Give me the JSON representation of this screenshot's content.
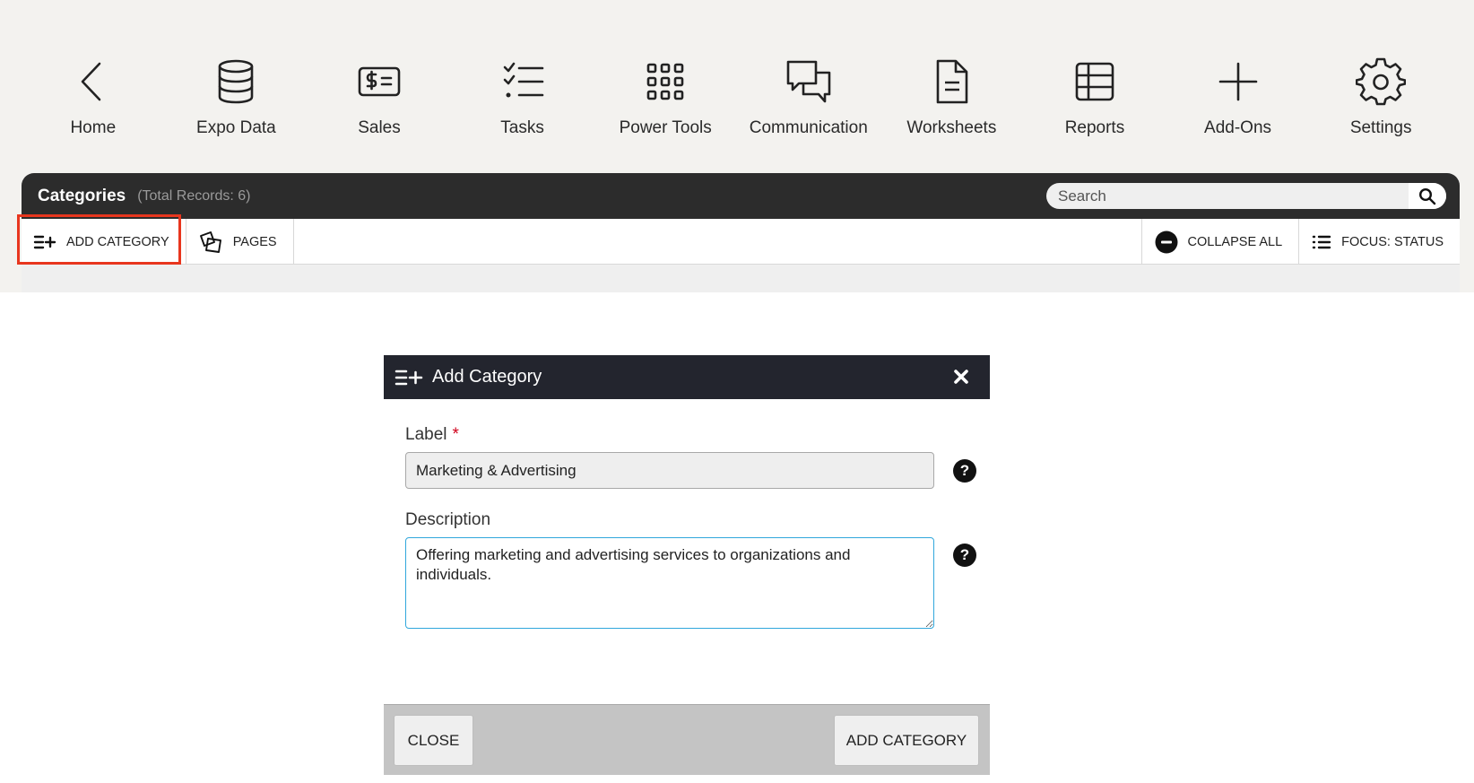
{
  "nav": {
    "items": [
      {
        "label": "Home",
        "icon": "chevron-left-icon"
      },
      {
        "label": "Expo Data",
        "icon": "database-icon"
      },
      {
        "label": "Sales",
        "icon": "dollar-bill-icon"
      },
      {
        "label": "Tasks",
        "icon": "checklist-icon"
      },
      {
        "label": "Power Tools",
        "icon": "grid-dots-icon"
      },
      {
        "label": "Communication",
        "icon": "chat-bubbles-icon"
      },
      {
        "label": "Worksheets",
        "icon": "document-icon"
      },
      {
        "label": "Reports",
        "icon": "table-icon"
      },
      {
        "label": "Add-Ons",
        "icon": "plus-icon"
      },
      {
        "label": "Settings",
        "icon": "gear-icon"
      }
    ]
  },
  "panel": {
    "title": "Categories",
    "count": "(Total Records: 6)",
    "search_placeholder": "Search"
  },
  "toolbar": {
    "add_category": "ADD CATEGORY",
    "pages": "PAGES",
    "collapse_all": "COLLAPSE ALL",
    "focus_status": "FOCUS: STATUS"
  },
  "modal": {
    "title": "Add Category",
    "label_field": {
      "label": "Label",
      "required_mark": "*",
      "value": "Marketing & Advertising"
    },
    "description_field": {
      "label": "Description",
      "value": "Offering marketing and advertising services to organizations and individuals."
    },
    "help_glyph": "?",
    "close_button": "CLOSE",
    "submit_button": "ADD CATEGORY"
  },
  "colors": {
    "header_dark": "#2c2c2c",
    "modal_header": "#23252e",
    "highlight": "#e8361e",
    "focus_border": "#31a7dc",
    "required": "#d0021b"
  }
}
